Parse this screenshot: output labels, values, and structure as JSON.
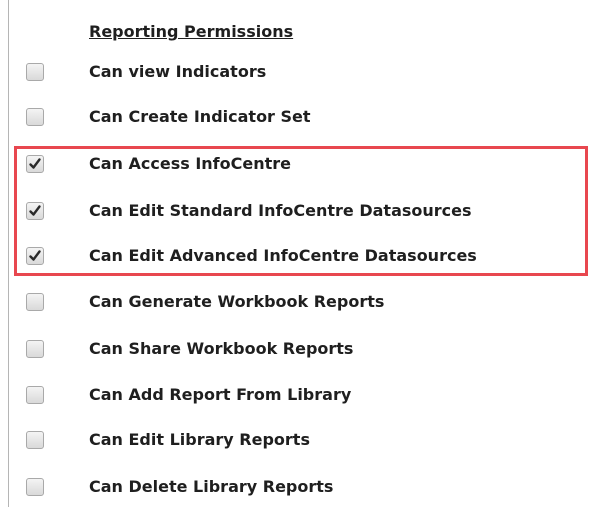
{
  "section": {
    "title": "Reporting Permissions"
  },
  "colors": {
    "highlight_border": "#e8474f",
    "text": "#1f1f1f",
    "checkmark": "#2a2a2a"
  },
  "permissions": [
    {
      "label": "Can view Indicators",
      "checked": false
    },
    {
      "label": "Can Create Indicator Set",
      "checked": false
    },
    {
      "label": "Can Access InfoCentre",
      "checked": true
    },
    {
      "label": "Can Edit Standard InfoCentre Datasources",
      "checked": true
    },
    {
      "label": "Can Edit Advanced InfoCentre Datasources",
      "checked": true
    },
    {
      "label": "Can Generate Workbook Reports",
      "checked": false
    },
    {
      "label": "Can Share Workbook Reports",
      "checked": false
    },
    {
      "label": "Can Add Report From Library",
      "checked": false
    },
    {
      "label": "Can Edit Library Reports",
      "checked": false
    },
    {
      "label": "Can Delete Library Reports",
      "checked": false
    }
  ]
}
